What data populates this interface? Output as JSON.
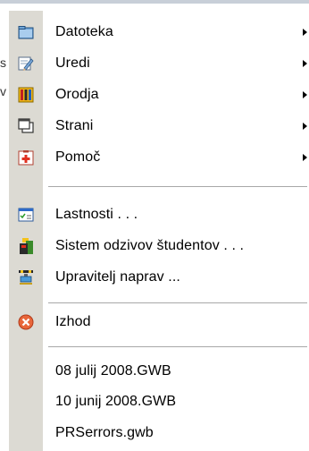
{
  "background_colors": {
    "gutter": "#dcdad3",
    "menu": "#ffffff",
    "separator": "#a8a8a8"
  },
  "behind_menu_letters": [
    "s",
    "v"
  ],
  "menu": {
    "groups": [
      [
        {
          "label": "Datoteka",
          "icon": "folder-icon",
          "submenu": true
        },
        {
          "label": "Uredi",
          "icon": "edit-pencil-icon",
          "submenu": true
        },
        {
          "label": "Orodja",
          "icon": "tools-icon",
          "submenu": true
        },
        {
          "label": "Strani",
          "icon": "pages-icon",
          "submenu": true
        },
        {
          "label": "Pomoč",
          "icon": "help-icon",
          "submenu": true
        }
      ],
      [
        {
          "label": "Lastnosti . . .",
          "icon": "properties-icon",
          "submenu": false
        },
        {
          "label": "Sistem odzivov študentov . . .",
          "icon": "student-response-icon",
          "submenu": false
        },
        {
          "label": "Upravitelj naprav ...",
          "icon": "device-manager-icon",
          "submenu": false
        }
      ],
      [
        {
          "label": "Izhod",
          "icon": "exit-icon",
          "submenu": false
        }
      ],
      [
        {
          "label": "08 julij 2008.GWB",
          "icon": "",
          "submenu": false
        },
        {
          "label": "10 junij 2008.GWB",
          "icon": "",
          "submenu": false
        },
        {
          "label": "PRSerrors.gwb",
          "icon": "",
          "submenu": false
        }
      ]
    ]
  }
}
